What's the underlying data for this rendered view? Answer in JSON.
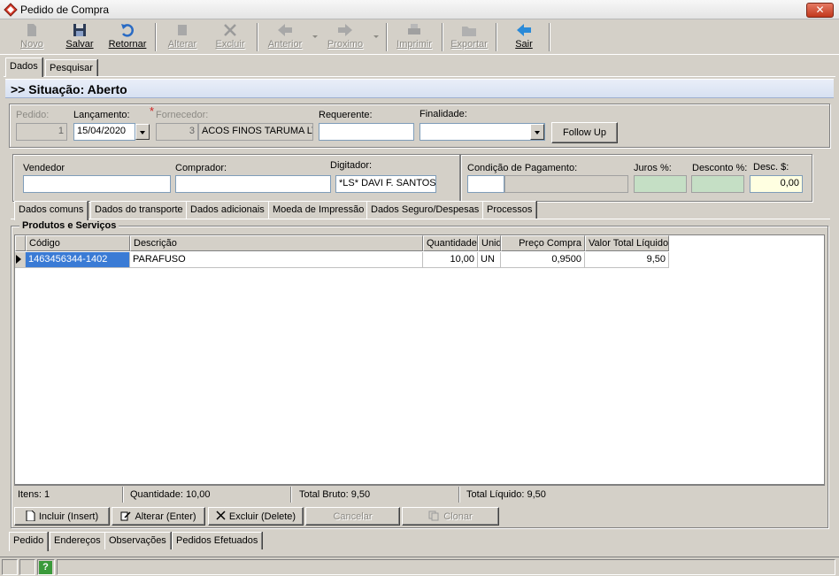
{
  "window": {
    "title": "Pedido de Compra",
    "close": "✕"
  },
  "toolbar": {
    "novo": "Novo",
    "salvar": "Salvar",
    "retornar": "Retornar",
    "alterar": "Alterar",
    "excluir": "Excluir",
    "anterior": "Anterior",
    "proximo": "Proximo",
    "imprimir": "Imprimir",
    "exportar": "Exportar",
    "sair": "Sair"
  },
  "top_tabs": [
    "Dados",
    "Pesquisar"
  ],
  "situacao": ">> Situação: Aberto",
  "header": {
    "pedido_label": "Pedido:",
    "pedido_value": "1",
    "lancamento_label": "Lançamento:",
    "lancamento_value": "15/04/2020",
    "fornecedor_label": "Fornecedor:",
    "fornecedor_code": "3",
    "fornecedor_name": "ACOS FINOS TARUMA LT",
    "requerente_label": "Requerente:",
    "requerente_value": "",
    "finalidade_label": "Finalidade:",
    "finalidade_value": "",
    "follow_up": "Follow Up"
  },
  "details": {
    "vendedor_label": "Vendedor",
    "vendedor_value": "",
    "comprador_label": "Comprador:",
    "comprador_value": "",
    "digitador_label": "Digitador:",
    "digitador_value": "*LS* DAVI F. SANTOS",
    "condicao_label": "Condição de Pagamento:",
    "condicao_code": "",
    "condicao_desc": "",
    "juros_label": "Juros %:",
    "juros_value": "",
    "desconto_label": "Desconto %:",
    "desconto_value": "",
    "desc_label": "Desc. $:",
    "desc_value": "0,00"
  },
  "sub_tabs": [
    "Dados comuns",
    "Dados do transporte",
    "Dados adicionais",
    "Moeda de Impressão",
    "Dados Seguro/Despesas",
    "Processos"
  ],
  "products": {
    "title": "Produtos e Serviços",
    "columns": [
      "Código",
      "Descrição",
      "Quantidade",
      "Unid",
      "Preço Compra",
      "Valor Total Líquido"
    ],
    "rows": [
      {
        "codigo": "1463456344-1402",
        "descricao": "PARAFUSO",
        "quantidade": "10,00",
        "unid": "UN",
        "preco": "0,9500",
        "total": "9,50"
      }
    ]
  },
  "summary": {
    "itens": "Itens: 1",
    "quantidade": "Quantidade: 10,00",
    "bruto": "Total Bruto: 9,50",
    "liquido": "Total Líquido: 9,50"
  },
  "actions": {
    "incluir": "Incluir (Insert)",
    "alterar": "Alterar (Enter)",
    "excluir": "Excluir (Delete)",
    "cancelar": "Cancelar",
    "clonar": "Clonar"
  },
  "bottom_tabs": [
    "Pedido",
    "Endereços",
    "Observações",
    "Pedidos Efetuados"
  ],
  "status": {
    "help": "?"
  }
}
